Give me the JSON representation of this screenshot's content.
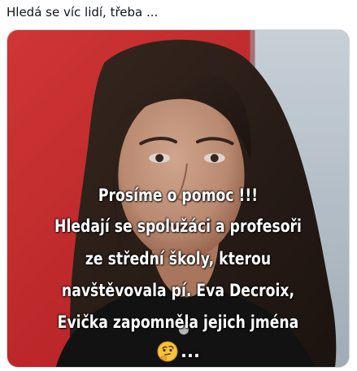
{
  "post": {
    "text": "Hledá se víc lidí, třeba ..."
  },
  "media": {
    "caption_lines": [
      "Prosíme o pomoc !!!",
      "Hledají se spolužáci a profesoři",
      "ze střední školy, kterou",
      "navštěvovala pí. Eva Decroix,",
      "Evička zapomněla jejich jména",
      "..."
    ],
    "emoji_icon": "thinking-face-icon"
  },
  "colors": {
    "text": "#0f1419",
    "border": "#cfd9de",
    "backdrop_red": "#d8262b",
    "backdrop_light": "#c8d3dc",
    "caption": "#ffffff"
  }
}
